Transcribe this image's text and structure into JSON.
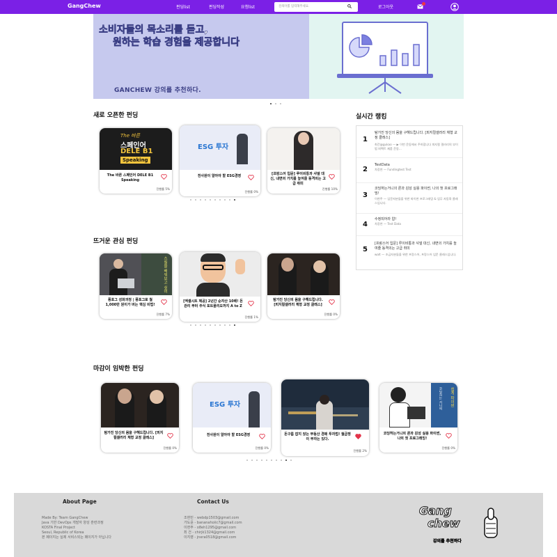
{
  "nav": {
    "logo": "GangChew",
    "links": [
      "펀딩list",
      "펀딩작성",
      "요청list"
    ],
    "search_placeholder": "검색어를 입력해주세요.",
    "login": "로그아웃",
    "mail_badge_color": "#e34"
  },
  "banner": {
    "headline_1": "소비자들의 목소리를 듣고,",
    "headline_2": "원하는 학습 경험을 제공합니다",
    "subline": "GANCHEW 강의를 추천하다.",
    "slide_index": 1,
    "slide_count": 3
  },
  "new_funding": {
    "title": "새로 오픈한 펀딩",
    "cards": [
      {
        "title": "The 바른 스페인어 DELE B1 Speaking",
        "progress": "진행률 5%",
        "thumb_text_1": "The 바른",
        "thumb_text_2": "스페인어",
        "thumb_text_3": "DELE B1",
        "thumb_text_4": "Speaking"
      },
      {
        "title": "전사원이 알아야 할 ESG경영",
        "progress": "진행률 0%",
        "thumb_text_1": "ESG 투자"
      },
      {
        "title": "[프랑스어 입문] 루이비통과 샤넬 대신, 내면의 가치를 높여줄 동격의는 고급 취미",
        "progress": "진행률 10%"
      }
    ]
  },
  "hot_funding": {
    "title": "뜨거운 관심 펀딩",
    "cards": [
      {
        "title": "풍포그 성화과정 | 풍포그로 월 1,000만 원이가 버는 핵심 비법!",
        "progress": "진행률 7%",
        "thumb_text_1": "스킬을 배워보고 싶어"
      },
      {
        "title": "[엑셀시트 제공] 2년간 순자산 10배! 돈관리 부터 주식 포트폴리오까지 A to Z",
        "progress": "진행률 1%"
      },
      {
        "title": "탐가진 당신의 몸을 구해드립니다. [피지컬갤러리 체형 교정 클래스]",
        "progress": "진행률 0%"
      }
    ]
  },
  "deadline_funding": {
    "title": "마감이 임박한 펀딩",
    "cards": [
      {
        "title": "탐가진 당신의 몸을 구해드립니다. [피지컬갤러리 체형 교정 클래스]",
        "progress": "진행률 0%",
        "liked": false
      },
      {
        "title": "전사원이 알아야 할 ESG경영",
        "progress": "진행률 0%",
        "liked": false,
        "thumb_text_1": "ESG 투자"
      },
      {
        "title": "돈구름 잡지 않는 부동산 경매 투자법! 월급쟁이 부자는 있다.",
        "progress": "진행률 2%",
        "liked": true
      },
      {
        "title": "코딩하는거니의 론과 감성 실용 파이썬, 나의 첫 프로그래밍!",
        "progress": "진행률 0%",
        "liked": false,
        "thumb_text_1": "코딩하는 거니의",
        "thumb_text_2": "쉽게 파이썬"
      }
    ]
  },
  "ranking": {
    "title": "실시간 랭킹",
    "items": [
      {
        "rank": "1",
        "title": "탐가진 당신의 몸을 구해드립니다. [피지컬갤러리 체형 교정 클래스]",
        "sub": "최건@gukao — ▶ 이번 운동에서 주하합니다 피지컬 갤러리의 부이범 피펙트 제품 운동..."
      },
      {
        "rank": "2",
        "title": "TestData",
        "sub": "차장연 — Fundingtest Test"
      },
      {
        "rank": "3",
        "title": "코딩하는거니의 론과 감성 실용 파이썬, 나의 첫 프로그래밍!",
        "sub": "이현주 — 입문자분들을 위한 파이썬 프로그래밍 & 업무 자동화 클래스입니다."
      },
      {
        "rank": "4",
        "title": "수정되어라 얍!",
        "sub": "차장연 — Test Data"
      },
      {
        "rank": "5",
        "title": "[프랑스어 입문] 루이비통과 샤넬 대신, 내면의 가치를 높여줄 동격의는 고급 취미",
        "sub": "walt — 조금자분들을 위한 프랑스어, 프랑스어 입문 클래스입니다."
      }
    ]
  },
  "footer": {
    "about_title": "About Page",
    "about_lines": [
      "Made By: Team GangChew",
      "Java 기반 DevOps 개발자 양성 훈련과정",
      "KOSTA Final Project",
      "Seoul, Republic of Korea",
      "본 페이지는 실제 서비스되는 페이지가 아닙니다"
    ],
    "contact_title": "Contact Us",
    "contact_lines": [
      "조현민 - webdp1503@gmail.com",
      "가도윤 - bananahoiic7@gmail.com",
      "이현주 - o8eh1295@gmail.com",
      "최 건 - chirjk1324@gmail.com",
      "이지영 - jnera0518@gmail.com"
    ],
    "logo_line_1": "Gang",
    "logo_line_2": "chew",
    "logo_tagline": "강의를 추천하다"
  },
  "colors": {
    "brand": "#7b20e6",
    "banner_left": "#c6c9ee",
    "banner_right": "#e2f5f1",
    "footer_bg": "#d9d9d9",
    "heart": "#e3344a"
  }
}
